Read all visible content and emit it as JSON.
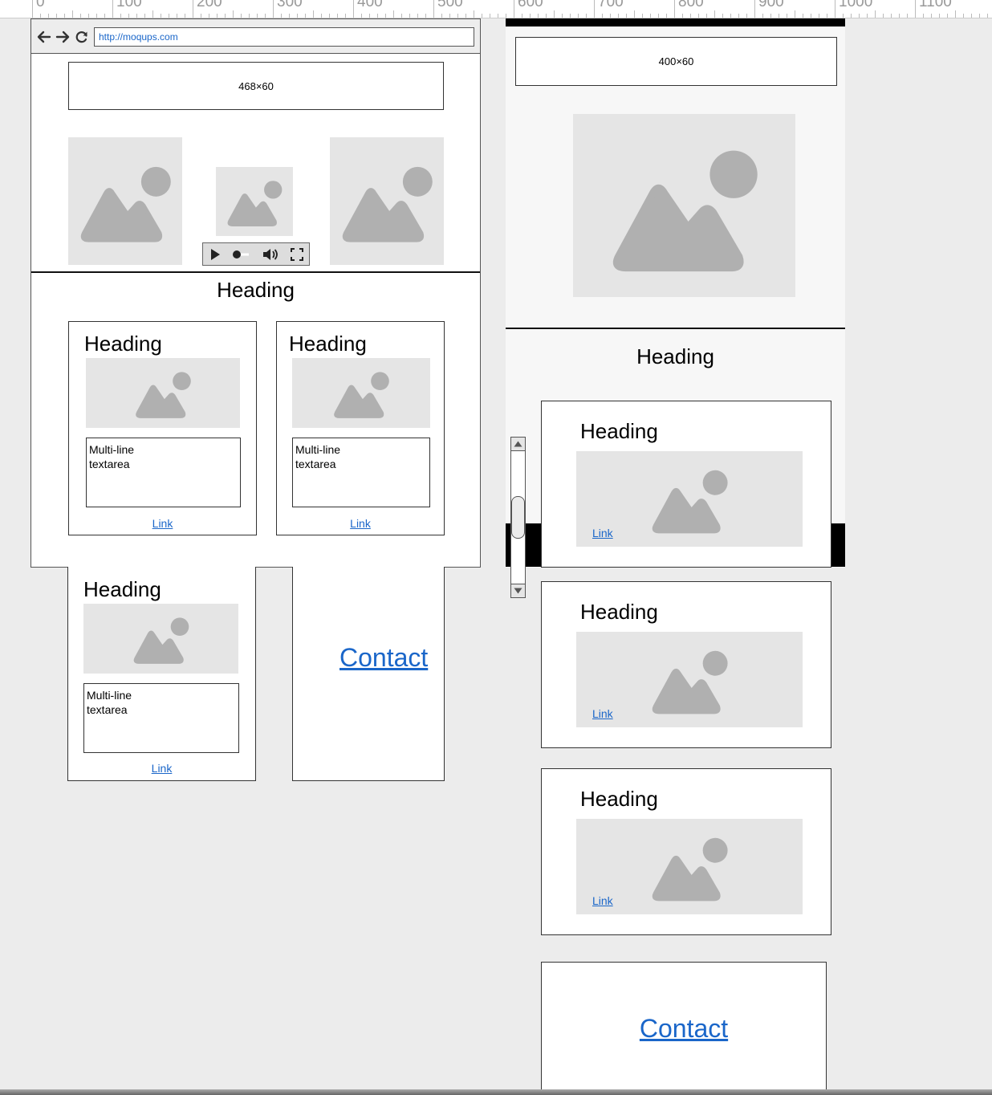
{
  "ruler": {
    "labels": [
      "0",
      "100",
      "200",
      "300",
      "400",
      "500",
      "600",
      "700",
      "800",
      "900",
      "1000",
      "1100"
    ]
  },
  "desktop": {
    "url": "http://moqups.com",
    "ad_label": "468×60",
    "section_heading": "Heading",
    "cards": [
      {
        "heading": "Heading",
        "textarea": "Multi-line\ntextarea",
        "link": "Link"
      },
      {
        "heading": "Heading",
        "textarea": "Multi-line\ntextarea",
        "link": "Link"
      },
      {
        "heading": "Heading",
        "textarea": "Multi-line\ntextarea",
        "link": "Link"
      }
    ],
    "contact": "Contact"
  },
  "mobile": {
    "ad_label": "400×60",
    "section_heading": "Heading",
    "cards": [
      {
        "heading": "Heading",
        "link": "Link"
      },
      {
        "heading": "Heading",
        "link": "Link"
      },
      {
        "heading": "Heading",
        "link": "Link"
      }
    ],
    "contact": "Contact"
  },
  "icons": {
    "back": "arrow-left-icon",
    "forward": "arrow-right-icon",
    "reload": "reload-icon",
    "play": "play-icon",
    "volume": "volume-icon",
    "fullscreen": "fullscreen-icon",
    "image": "image-placeholder-icon"
  },
  "colors": {
    "link": "#1a66c9",
    "placeholder_bg": "#e5e5e5",
    "placeholder_fg": "#b0b0b0",
    "canvas": "#ececec"
  }
}
